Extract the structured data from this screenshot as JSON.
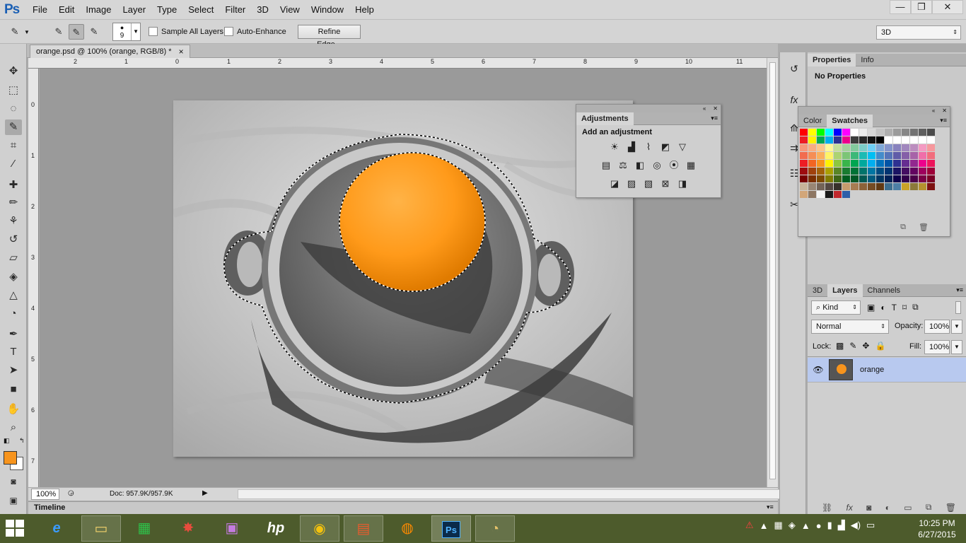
{
  "app": {
    "logo": "Ps",
    "menus": [
      "File",
      "Edit",
      "Image",
      "Layer",
      "Type",
      "Select",
      "Filter",
      "3D",
      "View",
      "Window",
      "Help"
    ]
  },
  "window_controls": {
    "minimize": "—",
    "restore": "❐",
    "close": "✕"
  },
  "options": {
    "brush_size": "9",
    "sample_all_layers": "Sample All Layers",
    "auto_enhance": "Auto-Enhance",
    "refine_edge": "Refine Edge...",
    "workspace": "3D"
  },
  "document": {
    "tab_title": "orange.psd @ 100% (orange, RGB/8) *",
    "close": "×"
  },
  "rulers": {
    "top": [
      "2",
      "1",
      "0",
      "1",
      "2",
      "3",
      "4",
      "5",
      "6",
      "7",
      "8",
      "9",
      "10",
      "11"
    ],
    "left": [
      "0",
      "1",
      "2",
      "3",
      "4",
      "5",
      "6",
      "7"
    ]
  },
  "status": {
    "zoom": "100%",
    "doc_info": "Doc: 957.9K/957.9K"
  },
  "timeline": {
    "label": "Timeline"
  },
  "adjustments": {
    "tab": "Adjustments",
    "heading": "Add an adjustment"
  },
  "properties": {
    "tabs": [
      "Properties",
      "Info"
    ],
    "content": "No Properties"
  },
  "color_swatches": {
    "tabs": [
      "Color",
      "Swatches"
    ]
  },
  "layers_panel": {
    "tabs": [
      "3D",
      "Layers",
      "Channels"
    ],
    "filter_kind": "Kind",
    "blend_mode": "Normal",
    "opacity_label": "Opacity:",
    "opacity_value": "100%",
    "lock_label": "Lock:",
    "fill_label": "Fill:",
    "fill_value": "100%",
    "layer_name": "orange"
  },
  "colors": {
    "foreground": "#f7941d",
    "background": "#ffffff",
    "layer_highlight": "#b8c9ef"
  },
  "taskbar": {
    "time": "10:25 PM",
    "date": "6/27/2015"
  }
}
